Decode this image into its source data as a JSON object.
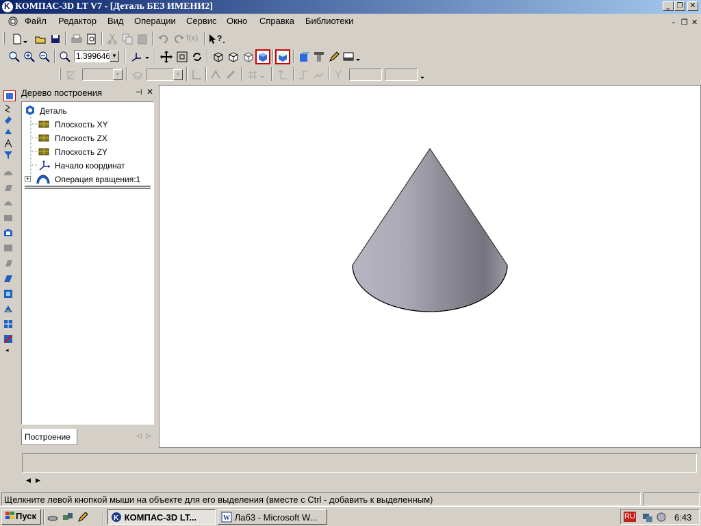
{
  "window": {
    "title": "КОМПАС-3D LT V7 - [Деталь БЕЗ ИМЕНИ2]",
    "controls": {
      "minimize": "_",
      "restore": "❐",
      "close": "✕"
    }
  },
  "menu": {
    "items": [
      "Файл",
      "Редактор",
      "Вид",
      "Операции",
      "Сервис",
      "Окно",
      "Справка",
      "Библиотеки"
    ],
    "mdi_controls": {
      "minimize": "–",
      "restore": "❐",
      "close": "✕"
    }
  },
  "toolbar_view": {
    "zoom_value": "1.399646"
  },
  "tree": {
    "title": "Дерево построения",
    "pin": "⊣",
    "close": "✕",
    "root": "Деталь",
    "nodes": [
      "Плоскость XY",
      "Плоскость ZX",
      "Плоскость ZY",
      "Начало координат",
      "Операция вращения:1"
    ],
    "expander": "+",
    "tab": "Построение",
    "tab_prev": "◁",
    "tab_next": "▷"
  },
  "command_panel": {
    "nav_prev": "◀",
    "nav_next": "▶"
  },
  "status": {
    "hint": "Щелкните левой кнопкой мыши на объекте для его выделения (вместе с Ctrl - добавить к выделенным)"
  },
  "taskbar": {
    "start": "Пуск",
    "tasks": [
      "КОМПАС-3D LT...",
      "Лаб3 - Microsoft W..."
    ],
    "lang": "RU",
    "clock": "6:43"
  },
  "colors": {
    "title_gradient_start": "#0a246a",
    "title_gradient_end": "#a6caf0",
    "face": "#d4d0c8",
    "viewport_bg": "#ffffff",
    "plane_icon": "#8a7a1a"
  }
}
